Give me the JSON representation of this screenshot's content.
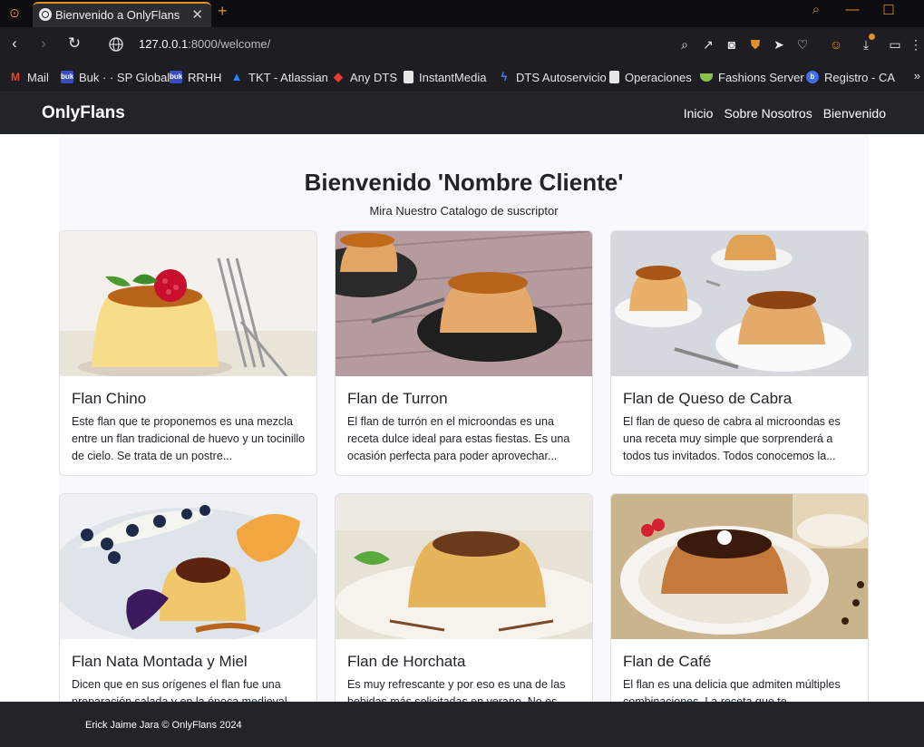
{
  "browser": {
    "tab": {
      "title": "Bienvenido a OnlyFlans",
      "close": "✕"
    },
    "new_tab": "+",
    "url_host": "127.0.0.1",
    "url_rest": ":8000/welcome/",
    "bookmarks": [
      {
        "label": "Mail",
        "icon": "gmail-icon",
        "color": "#ea4335"
      },
      {
        "label": "Buk · · SP Global",
        "icon": "buk-icon",
        "color": "#3b4cc0"
      },
      {
        "label": "RRHH",
        "icon": "buk-icon",
        "color": "#3b4cc0"
      },
      {
        "label": "TKT - Atlassian",
        "icon": "atlassian-icon",
        "color": "#2684ff"
      },
      {
        "label": "Any DTS",
        "icon": "diamond-icon",
        "color": "#e53935"
      },
      {
        "label": "InstantMedia",
        "icon": "document-icon",
        "color": "#e6e6e6"
      },
      {
        "label": "DTS Autoservicio",
        "icon": "bolt-icon",
        "color": "#3f83f8"
      },
      {
        "label": "Operaciones",
        "icon": "document-icon",
        "color": "#e6e6e6"
      },
      {
        "label": "Fashions Server",
        "icon": "bowl-icon",
        "color": "#8bc34a"
      },
      {
        "label": "Registro - CA",
        "icon": "b-icon",
        "color": "#3f6ee8"
      }
    ],
    "bookmarks_more": "»"
  },
  "site": {
    "brand": "OnlyFlans",
    "nav": [
      "Inicio",
      "Sobre Nosotros",
      "Bienvenido"
    ],
    "title": "Bienvenido 'Nombre Cliente'",
    "subtitle": "Mira Nuestro Catalogo de suscriptor",
    "cards": [
      {
        "title": "Flan Chino",
        "text": "Este flan que te proponemos es una mezcla entre un flan tradicional de huevo y un tocinillo de cielo. Se trata de un postre..."
      },
      {
        "title": "Flan de Turron",
        "text": "El flan de turrón en el microondas es una receta dulce ideal para estas fiestas. Es una ocasión perfecta para poder aprovechar..."
      },
      {
        "title": "Flan de Queso de Cabra",
        "text": "El flan de queso de cabra al microondas es una receta muy simple que sorprenderá a todos tus invitados. Todos conocemos la..."
      },
      {
        "title": "Flan Nata Montada y Miel",
        "text": "Dicen que en sus orígenes el flan fue una preparación salada y en la época medieval se..."
      },
      {
        "title": "Flan de Horchata",
        "text": "Es muy refrescante y por eso es una de las bebidas más solicitadas en verano. No es..."
      },
      {
        "title": "Flan de Café",
        "text": "El flan es una delicia que admiten múltiples combinaciones. La receta que te proponemos..."
      }
    ],
    "footer": "Erick Jaime Jara © OnlyFlans 2024"
  },
  "colors": {
    "accent": "#e0902f",
    "navbar": "#212529",
    "container": "#f8f9fa"
  }
}
